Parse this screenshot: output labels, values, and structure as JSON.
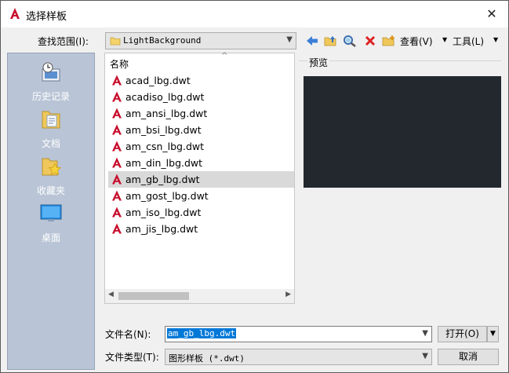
{
  "window": {
    "title": "选择样板",
    "close_glyph": "✕"
  },
  "lookin": {
    "label": "查找范围(I):",
    "value": "LightBackground"
  },
  "toolbar": {
    "buttons": [
      "back-icon",
      "up-folder-icon",
      "search-web-icon",
      "delete-icon",
      "new-folder-icon"
    ],
    "views_label": "查看(V)",
    "tools_label": "工具(L)"
  },
  "places": [
    {
      "label": "历史记录",
      "icon": "history-icon"
    },
    {
      "label": "文档",
      "icon": "documents-icon"
    },
    {
      "label": "收藏夹",
      "icon": "favorites-icon"
    },
    {
      "label": "桌面",
      "icon": "desktop-icon"
    }
  ],
  "filelist": {
    "column_name": "名称",
    "files": [
      "acad_lbg.dwt",
      "acadiso_lbg.dwt",
      "am_ansi_lbg.dwt",
      "am_bsi_lbg.dwt",
      "am_csn_lbg.dwt",
      "am_din_lbg.dwt",
      "am_gb_lbg.dwt",
      "am_gost_lbg.dwt",
      "am_iso_lbg.dwt",
      "am_jis_lbg.dwt"
    ],
    "selected_index": 6
  },
  "preview": {
    "label": "预览"
  },
  "bottom": {
    "filename_label": "文件名(N):",
    "filename_value": "am_gb_lbg.dwt",
    "filetype_label": "文件类型(T):",
    "filetype_value": "图形样板 (*.dwt)",
    "open_label": "打开(O)",
    "cancel_label": "取消"
  },
  "colors": {
    "accent": "#0078d7",
    "places_bg": "#b9c5d6",
    "preview_bg": "#23282e",
    "dwg_red": "#c8102e"
  }
}
